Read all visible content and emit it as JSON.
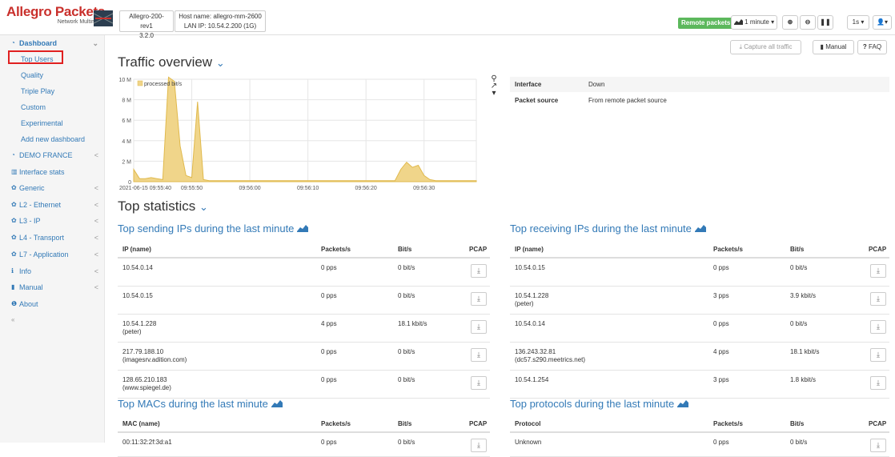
{
  "header": {
    "logo_title": "Allegro Packets",
    "logo_subtitle": "Network Multimeter",
    "device_name": "Allegro-200-rev1",
    "version": "3.2.0",
    "host_name": "Host name: allegro-mm-2600",
    "lan_ip": "LAN IP: 10.54.2.200 (1G)",
    "remote_badge": "Remote packets",
    "time_range": "1 minute",
    "refresh": "1s",
    "capture_label": "Capture all traffic",
    "manual_label": "Manual",
    "faq_label": "FAQ"
  },
  "sidebar": {
    "items": [
      {
        "label": "Dashboard",
        "icon": "dashboard-icon",
        "chevron": "⌄"
      },
      {
        "label": "Top Users"
      },
      {
        "label": "Quality"
      },
      {
        "label": "Triple Play"
      },
      {
        "label": "Custom"
      },
      {
        "label": "Experimental"
      },
      {
        "label": "Add new dashboard"
      },
      {
        "label": "DEMO FRANCE",
        "icon": "dashboard-icon",
        "chevron": "<"
      },
      {
        "label": "Interface stats",
        "icon": "bar-chart-icon"
      },
      {
        "label": "Generic",
        "icon": "gear-icon",
        "chevron": "<"
      },
      {
        "label": "L2 - Ethernet",
        "icon": "gear-icon",
        "chevron": "<"
      },
      {
        "label": "L3 - IP",
        "icon": "gear-icon",
        "chevron": "<"
      },
      {
        "label": "L4 - Transport",
        "icon": "gear-icon",
        "chevron": "<"
      },
      {
        "label": "L7 - Application",
        "icon": "gear-icon",
        "chevron": "<"
      },
      {
        "label": "Info",
        "icon": "info-icon",
        "chevron": "<"
      },
      {
        "label": "Manual",
        "icon": "book-icon",
        "chevron": "<"
      },
      {
        "label": "About",
        "icon": "info-circle-icon"
      },
      {
        "label": "«"
      }
    ]
  },
  "overview": {
    "title": "Traffic overview",
    "legend": "processed bit/s",
    "y_ticks": [
      "10 M",
      "8 M",
      "6 M",
      "4 M",
      "2 M",
      "0"
    ],
    "x_ticks": [
      "2021-06-15 09:55:40",
      "09:55:50",
      "09:56:00",
      "09:56:10",
      "09:56:20",
      "09:56:30"
    ],
    "info": [
      {
        "label": "Interface",
        "value": "Down"
      },
      {
        "label": "Packet source",
        "value": "From remote packet source"
      }
    ]
  },
  "chart_data": {
    "type": "area",
    "series": [
      {
        "name": "processed bit/s",
        "color": "#f0d58a"
      }
    ],
    "x": [
      0,
      1,
      2,
      3,
      4,
      5,
      6,
      7,
      8,
      9,
      10,
      11,
      12,
      13,
      14,
      15,
      16,
      17,
      18,
      19,
      20,
      21,
      22,
      23,
      24,
      25,
      26,
      27,
      28,
      29,
      30,
      31,
      32,
      33,
      34,
      35,
      36,
      37,
      38,
      39,
      40,
      41,
      42,
      43,
      44,
      45,
      46,
      47,
      48,
      49,
      50,
      51,
      52,
      53,
      54,
      55,
      56,
      57,
      58,
      59
    ],
    "values": [
      1.2,
      0.3,
      0.3,
      0.4,
      0.3,
      0.2,
      10.2,
      9.8,
      3.5,
      0.6,
      0.4,
      7.8,
      0.2,
      0.1,
      0.1,
      0.1,
      0.1,
      0.1,
      0.1,
      0.1,
      0.1,
      0.1,
      0.1,
      0.1,
      0.1,
      0.1,
      0.1,
      0.1,
      0.1,
      0.1,
      0.1,
      0.1,
      0.1,
      0.1,
      0.1,
      0.1,
      0.1,
      0.1,
      0.1,
      0.1,
      0.1,
      0.1,
      0.1,
      0.1,
      0.1,
      0.1,
      1.2,
      1.9,
      1.4,
      1.6,
      0.6,
      0.2,
      0.1,
      0.1,
      0.1,
      0.1,
      0.1,
      0.1,
      0.1,
      0.1
    ],
    "ylim": [
      0,
      10
    ],
    "unit": "M bit/s",
    "grid": true,
    "legend_position": "top-left"
  },
  "top_stats": {
    "title": "Top statistics",
    "sending": {
      "title": "Top sending IPs during the last minute",
      "headers": [
        "IP (name)",
        "Packets/s",
        "Bit/s",
        "PCAP"
      ],
      "rows": [
        {
          "ip": "10.54.0.14",
          "name": "",
          "pps": "0 pps",
          "bits": "0 bit/s"
        },
        {
          "ip": "10.54.0.15",
          "name": "",
          "pps": "0 pps",
          "bits": "0 bit/s"
        },
        {
          "ip": "10.54.1.228",
          "name": "(peter)",
          "pps": "4 pps",
          "bits": "18.1 kbit/s"
        },
        {
          "ip": "217.79.188.10",
          "name": "(imagesrv.adition.com)",
          "pps": "0 pps",
          "bits": "0 bit/s"
        },
        {
          "ip": "128.65.210.183",
          "name": "(www.spiegel.de)",
          "pps": "0 pps",
          "bits": "0 bit/s"
        }
      ]
    },
    "receiving": {
      "title": "Top receiving IPs during the last minute",
      "headers": [
        "IP (name)",
        "Packets/s",
        "Bit/s",
        "PCAP"
      ],
      "rows": [
        {
          "ip": "10.54.0.15",
          "name": "",
          "pps": "0 pps",
          "bits": "0 bit/s"
        },
        {
          "ip": "10.54.1.228",
          "name": "(peter)",
          "pps": "3 pps",
          "bits": "3.9 kbit/s"
        },
        {
          "ip": "10.54.0.14",
          "name": "",
          "pps": "0 pps",
          "bits": "0 bit/s"
        },
        {
          "ip": "136.243.32.81",
          "name": "(dc57.s290.meetrics.net)",
          "pps": "4 pps",
          "bits": "18.1 kbit/s"
        },
        {
          "ip": "10.54.1.254",
          "name": "",
          "pps": "3 pps",
          "bits": "1.8 kbit/s"
        }
      ]
    },
    "macs": {
      "title": "Top MACs during the last minute",
      "headers": [
        "MAC (name)",
        "Packets/s",
        "Bit/s",
        "PCAP"
      ],
      "rows": [
        {
          "mac": "00:11:32:2f:3d:a1",
          "pps": "0 pps",
          "bits": "0 bit/s"
        }
      ]
    },
    "protocols": {
      "title": "Top protocols during the last minute",
      "headers": [
        "Protocol",
        "Packets/s",
        "Bit/s",
        "PCAP"
      ],
      "rows": [
        {
          "protocol": "Unknown",
          "pps": "0 pps",
          "bits": "0 bit/s"
        }
      ]
    }
  }
}
